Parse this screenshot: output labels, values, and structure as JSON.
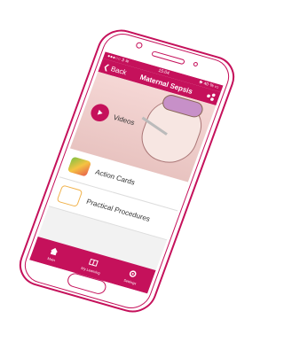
{
  "status": {
    "time": "15:04",
    "left": "●●●○○ 3 ≋",
    "right": "✱ 40 % ▭"
  },
  "nav": {
    "back": "Back",
    "title": "Maternal Sepsis"
  },
  "hero": {
    "label": "Videos"
  },
  "rows": [
    {
      "label": "Action Cards"
    },
    {
      "label": "Practical Procedures"
    }
  ],
  "tabs": [
    {
      "label": "Main"
    },
    {
      "label": "My Learning"
    },
    {
      "label": "Settings"
    }
  ],
  "colors": {
    "brand": "#c5115b"
  }
}
